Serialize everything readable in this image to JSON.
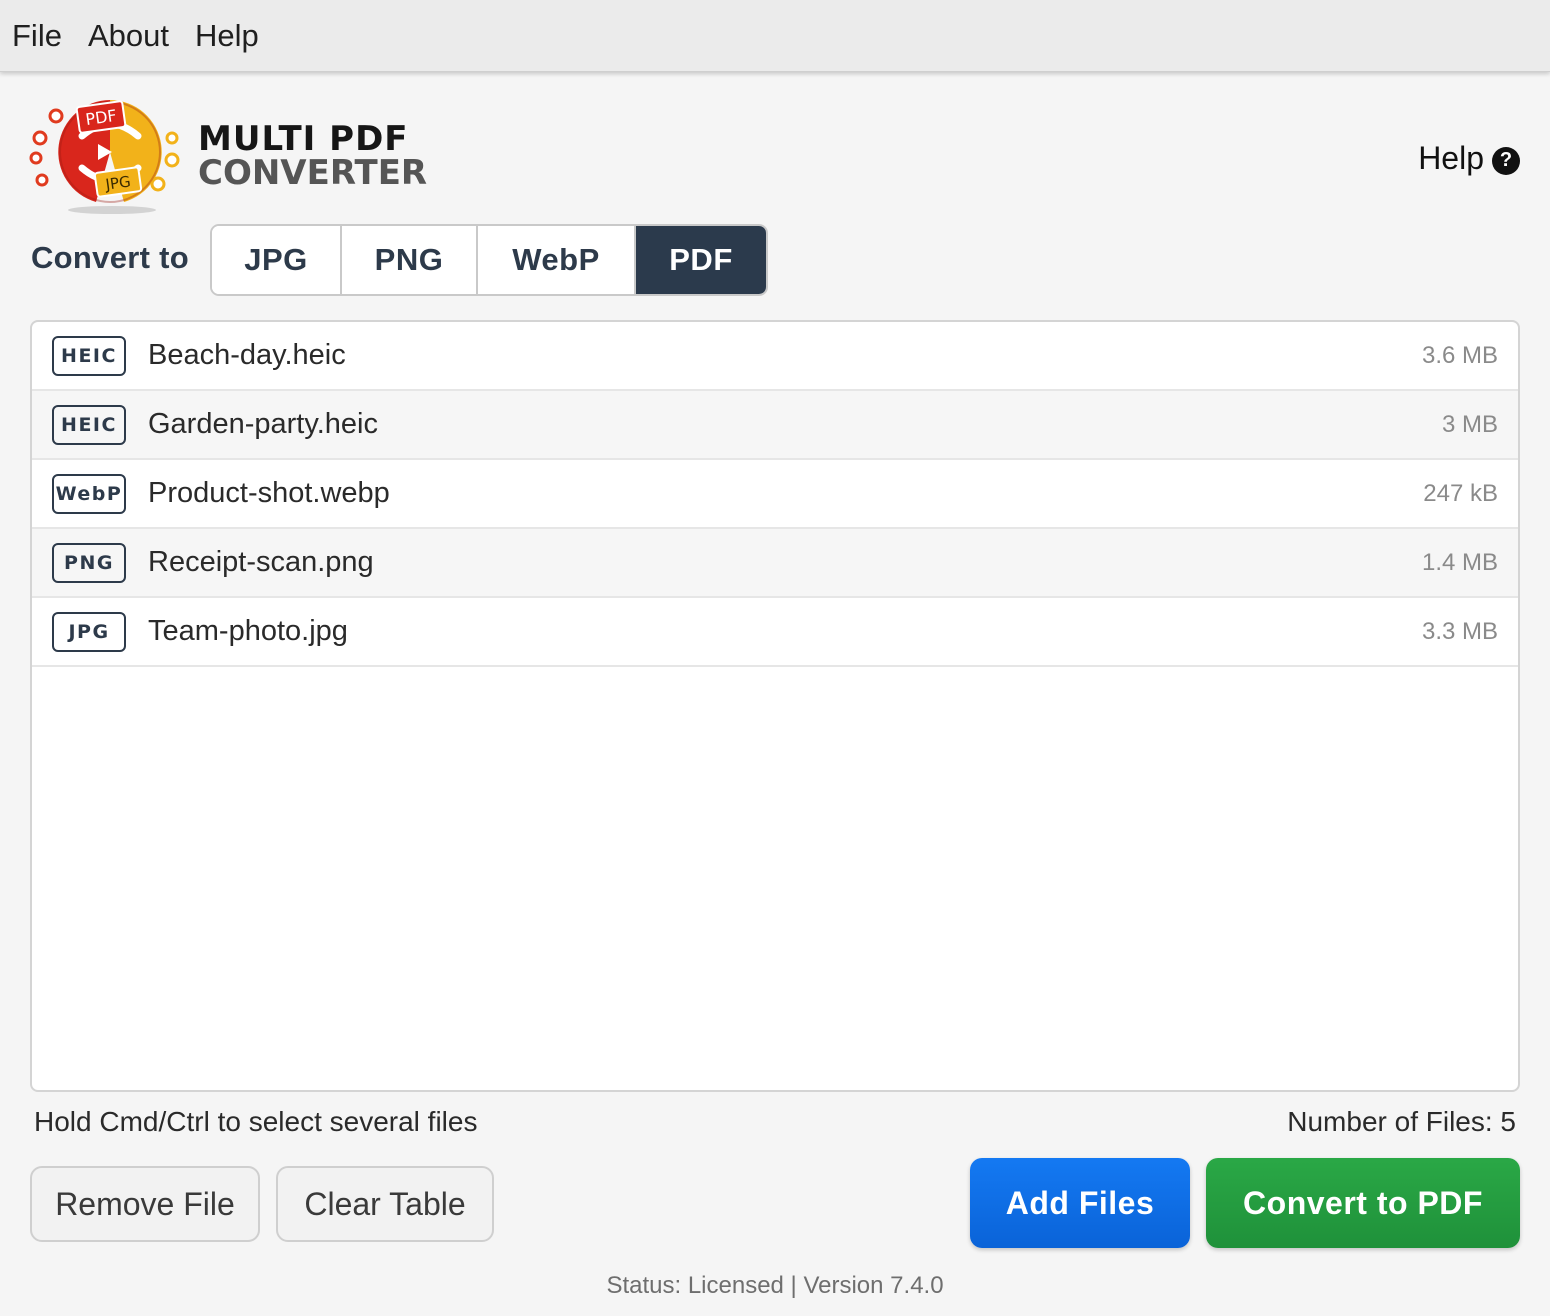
{
  "menu": {
    "items": [
      "File",
      "About",
      "Help"
    ]
  },
  "logo": {
    "line1": "MULTI PDF",
    "line2": "CONVERTER",
    "badge_top": "PDF",
    "badge_bottom": "JPG"
  },
  "help": {
    "label": "Help",
    "icon": "question-circle-icon",
    "glyph": "?"
  },
  "convert": {
    "label": "Convert to",
    "options": [
      "JPG",
      "PNG",
      "WebP",
      "PDF"
    ],
    "selected": "PDF"
  },
  "files": [
    {
      "type": "HEIC",
      "name": "Beach-day.heic",
      "size": "3.6 MB"
    },
    {
      "type": "HEIC",
      "name": "Garden-party.heic",
      "size": "3 MB"
    },
    {
      "type": "WebP",
      "name": "Product-shot.webp",
      "size": "247 kB"
    },
    {
      "type": "PNG",
      "name": "Receipt-scan.png",
      "size": "1.4 MB"
    },
    {
      "type": "JPG",
      "name": "Team-photo.jpg",
      "size": "3.3 MB"
    }
  ],
  "footer": {
    "hint": "Hold Cmd/Ctrl to select several files",
    "count": "Number of Files: 5",
    "remove_label": "Remove File",
    "clear_label": "Clear Table",
    "add_label": "Add Files",
    "convert_label": "Convert to PDF",
    "status": "Status: Licensed | Version 7.4.0"
  },
  "colors": {
    "primary_dark": "#2b3a4c",
    "add_blue": "#1479f2",
    "convert_green": "#2aa846"
  }
}
